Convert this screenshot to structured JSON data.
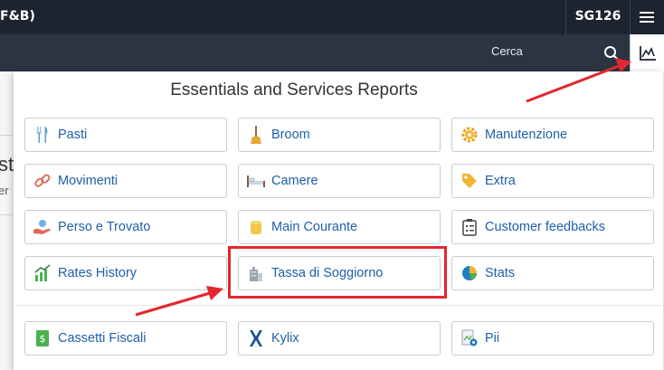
{
  "topbar": {
    "app_title": "F&B)",
    "property_code": "SG126",
    "menu_icon": "hamburger-icon"
  },
  "subbar": {
    "search_label": "Cerca",
    "search_icon": "search-icon",
    "reports_icon": "chart-icon"
  },
  "background": {
    "title_fragment": "st",
    "subtitle_fragment": "er"
  },
  "panel": {
    "title": "Essentials and Services Reports",
    "items": [
      {
        "label": "Pasti",
        "icon": "cutlery-icon"
      },
      {
        "label": "Broom",
        "icon": "broom-icon"
      },
      {
        "label": "Manutenzione",
        "icon": "gear-icon"
      },
      {
        "label": "Movimenti",
        "icon": "link-icon"
      },
      {
        "label": "Camere",
        "icon": "bed-icon"
      },
      {
        "label": "Extra",
        "icon": "tag-icon"
      },
      {
        "label": "Perso e Trovato",
        "icon": "hand-icon"
      },
      {
        "label": "Main Courante",
        "icon": "coins-icon"
      },
      {
        "label": "Customer feedbacks",
        "icon": "clipboard-icon"
      },
      {
        "label": "Rates History",
        "icon": "bar-chart-icon"
      },
      {
        "label": "Tassa di Soggiorno",
        "icon": "building-icon"
      },
      {
        "label": "Stats",
        "icon": "pie-chart-icon"
      }
    ],
    "extra_items": [
      {
        "label": "Cassetti Fiscali",
        "icon": "money-icon"
      },
      {
        "label": "Kylix",
        "icon": "kylix-logo-icon"
      },
      {
        "label": "Pii",
        "icon": "document-gear-icon"
      }
    ]
  },
  "annotation": {
    "highlight_color": "#e3272f"
  },
  "colors": {
    "topbar": "#1d2430",
    "subbar": "#2c3441",
    "link": "#1f5fa8"
  }
}
